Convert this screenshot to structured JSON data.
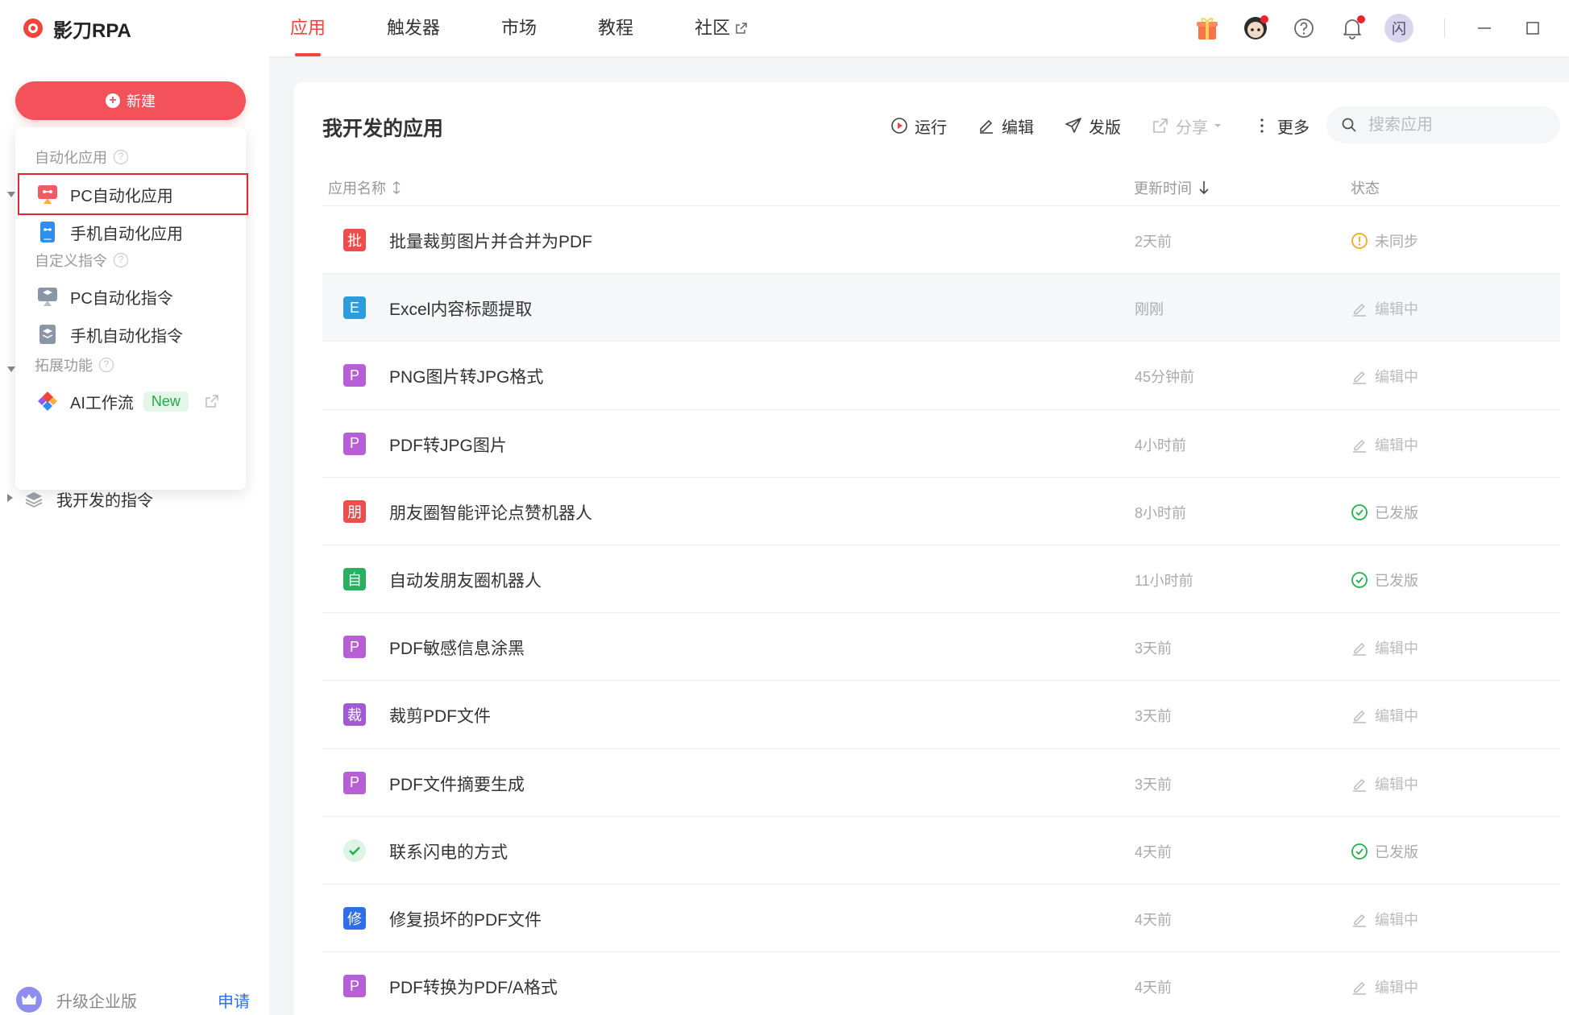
{
  "brand": {
    "name": "影刀RPA"
  },
  "nav": [
    {
      "label": "应用",
      "active": true,
      "external": false
    },
    {
      "label": "触发器",
      "active": false,
      "external": false
    },
    {
      "label": "市场",
      "active": false,
      "external": false
    },
    {
      "label": "教程",
      "active": false,
      "external": false
    },
    {
      "label": "社区",
      "active": false,
      "external": true
    }
  ],
  "user": {
    "avatar_text": "闪"
  },
  "sidebar": {
    "new_button": "新建",
    "bg_items": {
      "my_commands": "我开发的指令"
    },
    "upgrade": {
      "label": "升级企业版",
      "apply": "申请"
    }
  },
  "dropdown": {
    "sections": {
      "auto_apps": "自动化应用",
      "custom_cmds": "自定义指令",
      "extensions": "拓展功能"
    },
    "items": {
      "pc_app": "PC自动化应用",
      "mobile_app": "手机自动化应用",
      "pc_cmd": "PC自动化指令",
      "mobile_cmd": "手机自动化指令",
      "ai_flow": "AI工作流",
      "new_badge": "New"
    }
  },
  "panel": {
    "title": "我开发的应用",
    "toolbar": {
      "run": "运行",
      "edit": "编辑",
      "publish": "发版",
      "share": "分享",
      "more": "更多"
    },
    "search_placeholder": "搜索应用",
    "columns": {
      "name": "应用名称",
      "time": "更新时间",
      "status": "状态"
    }
  },
  "colors": {
    "accent": "#f0443c",
    "green": "#22b14c",
    "orange": "#f5a623",
    "link": "#2f6ee6"
  },
  "apps": [
    {
      "icon": "批",
      "color": "#ec4e4e",
      "name": "批量裁剪图片并合并为PDF",
      "time": "2天前",
      "status": "未同步",
      "type": "pending"
    },
    {
      "icon": "E",
      "color": "#2d9cdb",
      "name": "Excel内容标题提取",
      "time": "刚刚",
      "status": "编辑中",
      "type": "edit"
    },
    {
      "icon": "P",
      "color": "#b760d6",
      "name": "PNG图片转JPG格式",
      "time": "45分钟前",
      "status": "编辑中",
      "type": "edit"
    },
    {
      "icon": "P",
      "color": "#b760d6",
      "name": "PDF转JPG图片",
      "time": "4小时前",
      "status": "编辑中",
      "type": "edit"
    },
    {
      "icon": "朋",
      "color": "#ec4e4e",
      "name": "朋友圈智能评论点赞机器人",
      "time": "8小时前",
      "status": "已发版",
      "type": "ok"
    },
    {
      "icon": "自",
      "color": "#2aae5f",
      "name": "自动发朋友圈机器人",
      "time": "11小时前",
      "status": "已发版",
      "type": "ok"
    },
    {
      "icon": "P",
      "color": "#b760d6",
      "name": "PDF敏感信息涂黑",
      "time": "3天前",
      "status": "编辑中",
      "type": "edit"
    },
    {
      "icon": "裁",
      "color": "#a05ad2",
      "name": "裁剪PDF文件",
      "time": "3天前",
      "status": "编辑中",
      "type": "edit"
    },
    {
      "icon": "P",
      "color": "#b760d6",
      "name": "PDF文件摘要生成",
      "time": "3天前",
      "status": "编辑中",
      "type": "edit"
    },
    {
      "icon": "",
      "color": "#dff4e4",
      "name": "联系闪电的方式",
      "time": "4天前",
      "status": "已发版",
      "type": "ok",
      "check": true
    },
    {
      "icon": "修",
      "color": "#2f6ee6",
      "name": "修复损坏的PDF文件",
      "time": "4天前",
      "status": "编辑中",
      "type": "edit"
    },
    {
      "icon": "P",
      "color": "#b760d6",
      "name": "PDF转换为PDF/A格式",
      "time": "4天前",
      "status": "编辑中",
      "type": "edit"
    }
  ]
}
